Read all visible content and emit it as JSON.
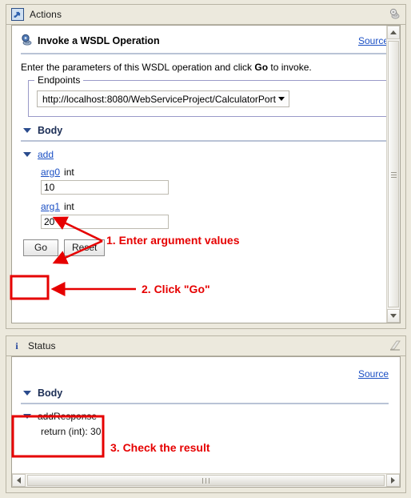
{
  "actions_panel": {
    "title": "Actions",
    "icon": "actions-arrow-icon",
    "titlebar_button": "view-menu-icon",
    "form": {
      "heading": "Invoke a WSDL Operation",
      "heading_icon": "wsdl-service-icon",
      "source_link": "Source",
      "instruction_prefix": "Enter the parameters of this WSDL operation and click ",
      "instruction_bold": "Go",
      "instruction_suffix": " to invoke.",
      "endpoints": {
        "legend": "Endpoints",
        "selected_value": "http://localhost:8080/WebServiceProject/CalculatorPort"
      },
      "body_section": "Body",
      "operation": "add",
      "arguments": [
        {
          "name": "arg0",
          "type": "int",
          "value": "10"
        },
        {
          "name": "arg1",
          "type": "int",
          "value": "20"
        }
      ],
      "buttons": {
        "go": "Go",
        "reset": "Reset"
      }
    },
    "scrollbar": {
      "up_icon": "triangle-up-icon",
      "down_icon": "triangle-down-icon",
      "thumb": "vertical-scroll-thumb"
    }
  },
  "status_panel": {
    "title": "Status",
    "icon": "info-icon",
    "titlebar_button": "maximize-icon",
    "source_link": "Source",
    "body_section": "Body",
    "response_name": "addResponse",
    "response_value": "return (int): 30",
    "scrollbar": {
      "left_icon": "triangle-left-icon",
      "right_icon": "triangle-right-icon",
      "thumb": "horizontal-scroll-thumb"
    }
  },
  "annotations": {
    "color": "#e60000",
    "steps": [
      {
        "id": "step-1",
        "label": "1. Enter argument values"
      },
      {
        "id": "step-2",
        "label": "2. Click \"Go\""
      },
      {
        "id": "step-3",
        "label": "3. Check the result"
      }
    ]
  }
}
